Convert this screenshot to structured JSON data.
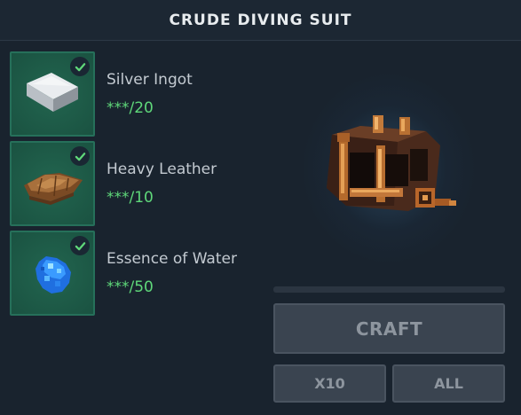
{
  "header": {
    "title": "CRUDE DIVING SUIT"
  },
  "ingredients": [
    {
      "name": "Silver Ingot",
      "count": "***/20",
      "icon": "silver-ingot-icon",
      "checked": true
    },
    {
      "name": "Heavy Leather",
      "count": "***/10",
      "icon": "heavy-leather-icon",
      "checked": true
    },
    {
      "name": "Essence of Water",
      "count": "***/50",
      "icon": "essence-of-water-icon",
      "checked": true
    }
  ],
  "preview": {
    "icon": "crude-diving-suit-icon"
  },
  "progress": {
    "value": 0
  },
  "actions": {
    "craft_label": "CRAFT",
    "x10_label": "X10",
    "all_label": "ALL"
  },
  "colors": {
    "background": "#19232e",
    "slot": "#1b5845",
    "count": "#5fd87a",
    "check": "#5fd87a",
    "button": "#3a4450"
  }
}
